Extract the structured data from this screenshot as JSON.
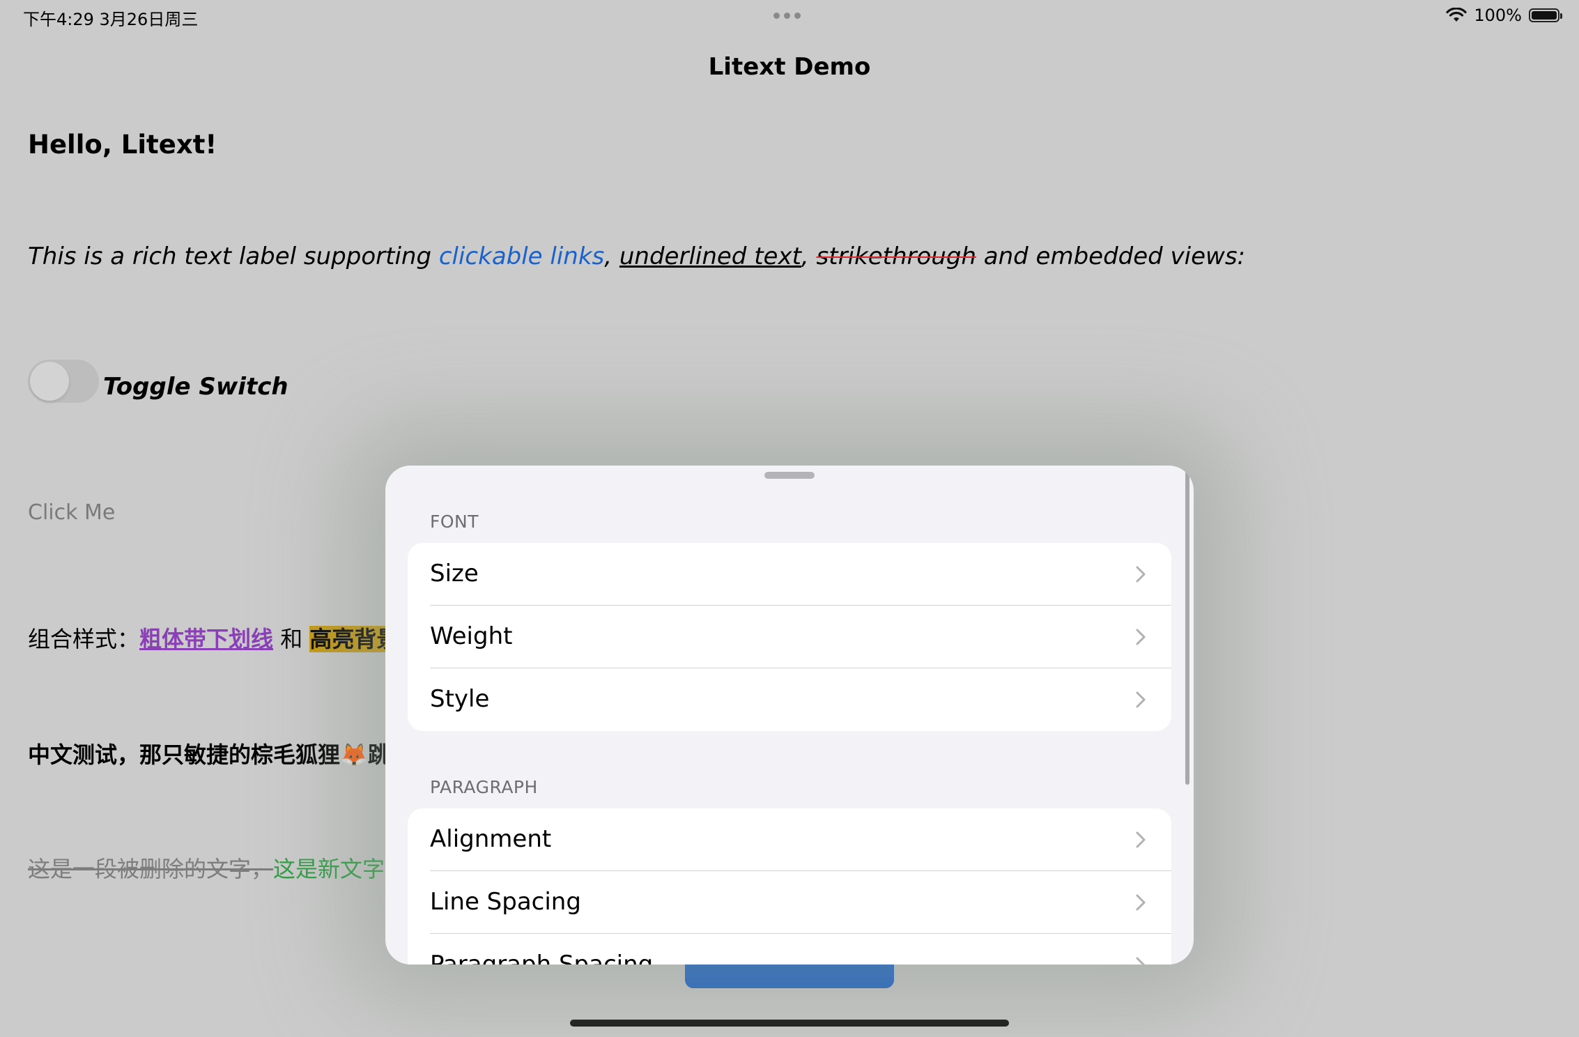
{
  "status_bar": {
    "time": "下午4:29   3月26日周三",
    "battery_percent": "100%"
  },
  "nav": {
    "title": "Litext Demo"
  },
  "content": {
    "hello": "Hello, Litext!",
    "rich": {
      "prefix": "This is a rich text label supporting ",
      "link": "clickable links",
      "sep1": ", ",
      "underlined": "underlined text",
      "sep2": ", ",
      "strike": "strikethrough",
      "suffix": " and embedded views:"
    },
    "toggle_label": "Toggle Switch",
    "click_me": "Click Me",
    "combo": {
      "prefix": "组合样式：",
      "purple": "粗体带下划线",
      "mid": " 和 ",
      "highlight": "高亮背景"
    },
    "chinese": "中文测试，那只敏捷的棕毛狐狸🦊跳",
    "deleted": {
      "gone": "这是一段被删除的文字，",
      "new": "这是新文字,"
    }
  },
  "sheet": {
    "sections": [
      {
        "header": "FONT",
        "rows": [
          "Size",
          "Weight",
          "Style"
        ]
      },
      {
        "header": "PARAGRAPH",
        "rows": [
          "Alignment",
          "Line Spacing",
          "Paragraph Spacing"
        ]
      }
    ]
  }
}
